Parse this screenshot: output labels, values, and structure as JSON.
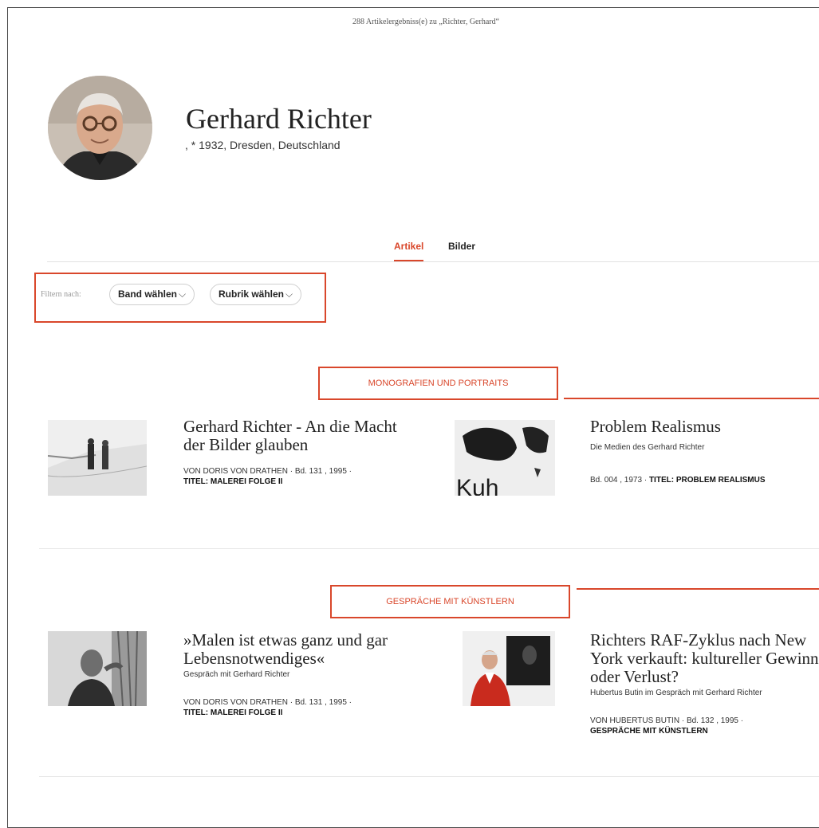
{
  "header": {
    "results_count": "288 Artikelergebniss(e) zu „Richter, Gerhard“"
  },
  "artist": {
    "name": "Gerhard Richter",
    "life": ", * 1932, Dresden, Deutschland"
  },
  "tabs": [
    {
      "label": "Artikel",
      "active": true
    },
    {
      "label": "Bilder",
      "active": false
    }
  ],
  "filter": {
    "label": "Filtern nach:",
    "band": "Band wählen",
    "rubrik": "Rubrik wählen",
    "chevron": "⌵"
  },
  "sections": [
    {
      "title": "MONOGRAFIEN UND PORTRAITS",
      "articles": [
        {
          "title": "Gerhard Richter - An die Macht der Bilder glauben",
          "subtitle": "",
          "meta1": "VON DORIS VON DRATHEN · Bd. 131 , 1995 ·",
          "meta2": "TITEL: MALEREI FOLGE II"
        },
        {
          "title": "Problem Realismus",
          "subtitle": "Die Medien des Gerhard Richter",
          "meta1": "Bd. 004 , 1973 ·",
          "meta2": "TITEL: PROBLEM REALISMUS",
          "thumb_text": "Kuh"
        }
      ]
    },
    {
      "title": "GESPRÄCHE MIT KÜNSTLERN",
      "articles": [
        {
          "title": "»Malen ist etwas ganz und gar Lebensnotwendiges«",
          "subtitle": "Gespräch mit Gerhard Richter",
          "meta1": "VON DORIS VON DRATHEN · Bd. 131 , 1995 ·",
          "meta2": "TITEL: MALEREI FOLGE II"
        },
        {
          "title": "Richters RAF-Zyklus nach New York verkauft: kultureller Gewinn oder Verlust?",
          "subtitle": "Hubertus Butin im Gespräch mit Gerhard Richter",
          "meta1": "VON HUBERTUS BUTIN · Bd. 132 , 1995 ·",
          "meta2": "GESPRÄCHE MIT KÜNSTLERN"
        }
      ]
    }
  ],
  "colors": {
    "accent": "#d9472b",
    "text": "#222222",
    "divider": "#e6e6e6"
  }
}
